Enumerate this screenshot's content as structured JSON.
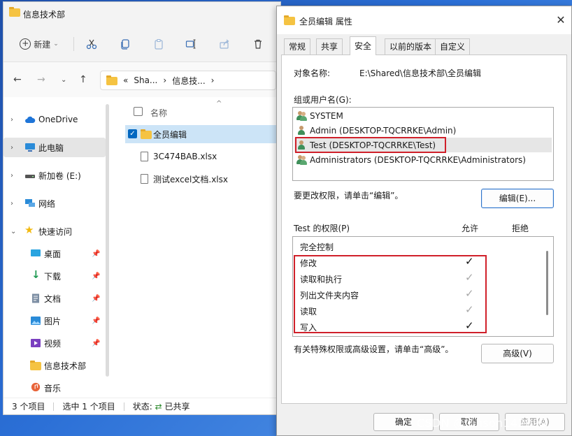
{
  "explorer": {
    "title": "信息技术部",
    "toolbar": {
      "new_label": "新建",
      "icons": [
        "cut-icon",
        "copy-icon",
        "paste-icon",
        "rename-icon",
        "share-icon",
        "delete-icon"
      ]
    },
    "address": {
      "prefix": "«",
      "segments": [
        "Sha...",
        "信息技...",
        ""
      ],
      "separator": "›"
    },
    "sidebar": {
      "items": [
        {
          "label": "OneDrive",
          "icon": "cloud-icon",
          "expandable": true,
          "pinned": false
        },
        {
          "label": "此电脑",
          "icon": "computer-icon",
          "expandable": true,
          "pinned": false,
          "selected": true
        },
        {
          "label": "新加卷 (E:)",
          "icon": "drive-icon",
          "expandable": true,
          "pinned": false
        },
        {
          "label": "网络",
          "icon": "network-icon",
          "expandable": true,
          "pinned": false
        },
        {
          "label": "快速访问",
          "icon": "star-icon",
          "expandable": true,
          "expanded": true,
          "pinned": false
        },
        {
          "label": "桌面",
          "icon": "desktop-icon",
          "expandable": false,
          "pinned": true
        },
        {
          "label": "下载",
          "icon": "download-icon",
          "expandable": false,
          "pinned": true
        },
        {
          "label": "文档",
          "icon": "document-icon",
          "expandable": false,
          "pinned": true
        },
        {
          "label": "图片",
          "icon": "picture-icon",
          "expandable": false,
          "pinned": true
        },
        {
          "label": "视频",
          "icon": "video-icon",
          "expandable": false,
          "pinned": true
        },
        {
          "label": "信息技术部",
          "icon": "folder-icon",
          "expandable": false,
          "pinned": false
        },
        {
          "label": "音乐",
          "icon": "music-icon",
          "expandable": false,
          "pinned": false
        }
      ]
    },
    "files": {
      "column_name": "名称",
      "rows": [
        {
          "name": "全员编辑",
          "type": "folder",
          "selected": true
        },
        {
          "name": "3C474BAB.xlsx",
          "type": "file",
          "selected": false
        },
        {
          "name": "测试excel文档.xlsx",
          "type": "file",
          "selected": false
        }
      ]
    },
    "status": {
      "count": "3 个项目",
      "selection": "选中 1 个项目",
      "state_label": "状态:",
      "state_value": "已共享"
    }
  },
  "dialog": {
    "title": "全员编辑 属性",
    "tabs": [
      "常规",
      "共享",
      "安全",
      "以前的版本",
      "自定义"
    ],
    "active_tab": "安全",
    "object_label": "对象名称:",
    "object_value": "E:\\Shared\\信息技术部\\全员编辑",
    "group_label": "组或用户名(G):",
    "users": [
      {
        "name": "SYSTEM",
        "icon": "user-group-icon"
      },
      {
        "name": "Admin (DESKTOP-TQCRRKE\\Admin)",
        "icon": "user-icon"
      },
      {
        "name": "Test (DESKTOP-TQCRRKE\\Test)",
        "icon": "user-icon",
        "selected": true
      },
      {
        "name": "Administrators (DESKTOP-TQCRRKE\\Administrators)",
        "icon": "user-group-icon"
      }
    ],
    "change_hint": "要更改权限，请单击“编辑”。",
    "edit_button": "编辑(E)...",
    "perm_label": "Test 的权限(P)",
    "allow_header": "允许",
    "deny_header": "拒绝",
    "permissions": [
      {
        "name": "完全控制",
        "allow": "",
        "deny": ""
      },
      {
        "name": "修改",
        "allow": "✓",
        "allow_style": "strong",
        "deny": ""
      },
      {
        "name": "读取和执行",
        "allow": "✓",
        "allow_style": "weak",
        "deny": ""
      },
      {
        "name": "列出文件夹内容",
        "allow": "✓",
        "allow_style": "weak",
        "deny": ""
      },
      {
        "name": "读取",
        "allow": "✓",
        "allow_style": "weak",
        "deny": ""
      },
      {
        "name": "写入",
        "allow": "✓",
        "allow_style": "strong",
        "deny": ""
      }
    ],
    "advanced_hint": "有关特殊权限或高级设置，请单击“高级”。",
    "advanced_button": "高级(V)",
    "ok_button": "确定",
    "cancel_button": "取消",
    "apply_button": "应用(A)",
    "close_glyph": "✕"
  },
  "watermark": "CSDN @Junson142099",
  "colors": {
    "highlight_red": "#d0202a",
    "selection_blue": "#cce4f7",
    "folder_yellow": "#f5c342",
    "accent_blue": "#0067c0"
  }
}
